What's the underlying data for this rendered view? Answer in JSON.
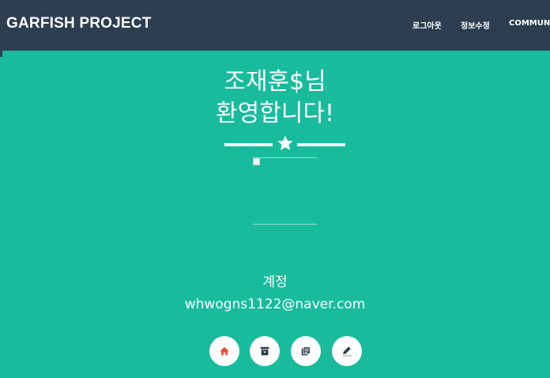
{
  "navbar": {
    "brand": "GARFISH PROJECT",
    "links": [
      "로그아웃",
      "정보수정",
      "COMMUNITY"
    ]
  },
  "main": {
    "title_line1": "조재훈$님",
    "title_line2": "환영합니다!",
    "divider_icon": "star-icon",
    "account_label": "계정",
    "account_email": "whwogns1122@naver.com"
  },
  "action_icons": [
    "home-icon",
    "archive-icon",
    "book-icon",
    "pencil-icon"
  ],
  "colors": {
    "navbar_bg": "#2c3e50",
    "page_bg": "#18bc9c",
    "text": "#ffffff",
    "home_icon": "#e74c3c",
    "dark_icon": "#2c3e50"
  }
}
